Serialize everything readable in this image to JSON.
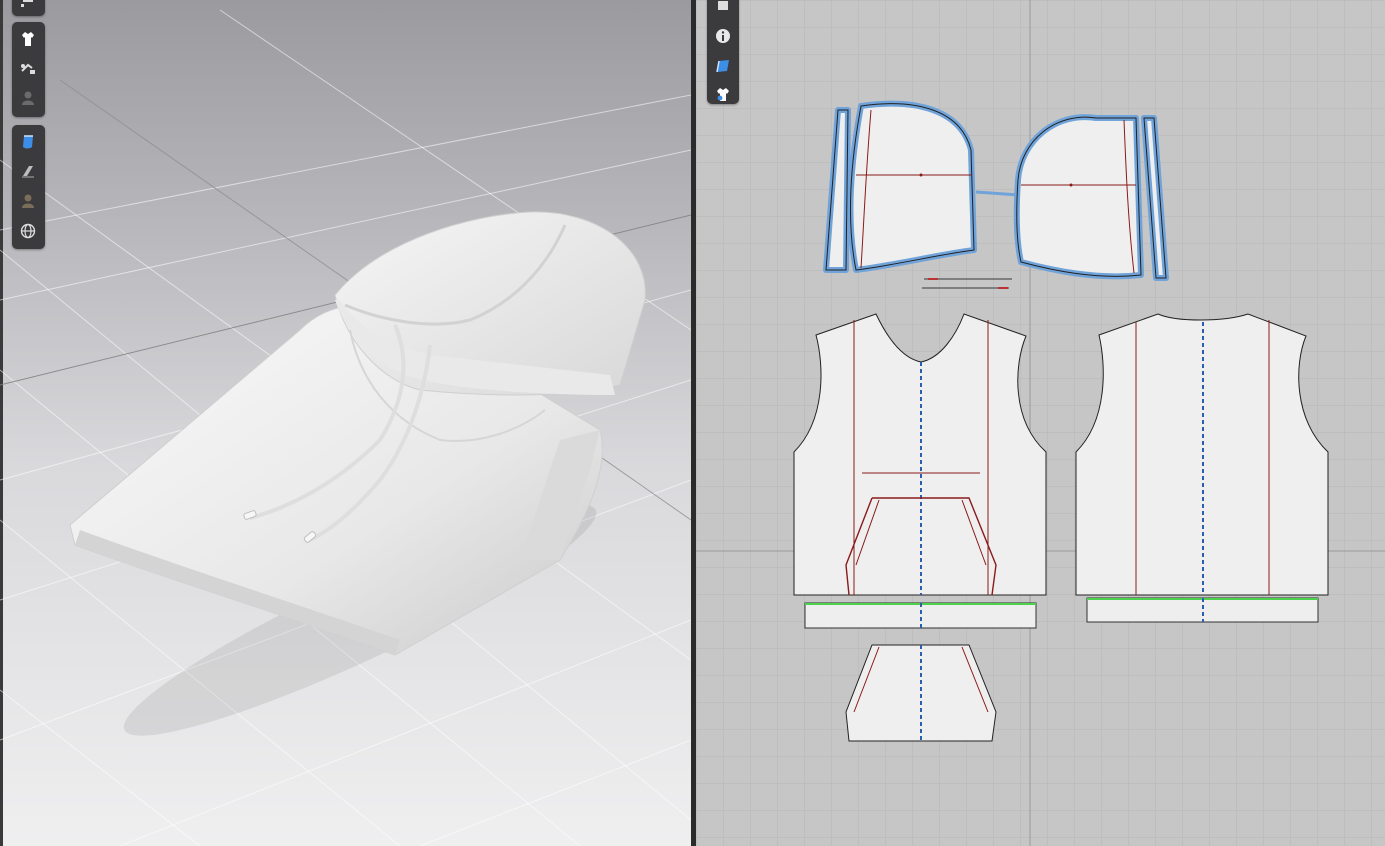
{
  "app": {
    "left_panel": "3d-view",
    "right_panel": "2d-pattern-view"
  },
  "toolbar_3d": {
    "groups": [
      {
        "items": [
          "layer-icon"
        ]
      },
      {
        "items": [
          "garment-icon",
          "hanger-icon",
          "avatar-icon"
        ]
      },
      {
        "items": [
          "texture-icon",
          "thickness-icon",
          "avatar-transparency-icon",
          "globe-icon"
        ]
      }
    ]
  },
  "toolbar_2d": {
    "items": [
      "page-icon",
      "info-icon",
      "texture-2d-icon",
      "garment-settings-icon"
    ]
  },
  "colors": {
    "grid_bg_2d": "#c6c6c6",
    "pattern_fill": "#efefef",
    "selection_blue": "#6fa3d9",
    "internal_line_red": "#8b1a1a",
    "symmetry_blue": "#2a5fb0",
    "seam_green": "#4cd24c",
    "toolbar_bg": "#3b3b3d"
  }
}
